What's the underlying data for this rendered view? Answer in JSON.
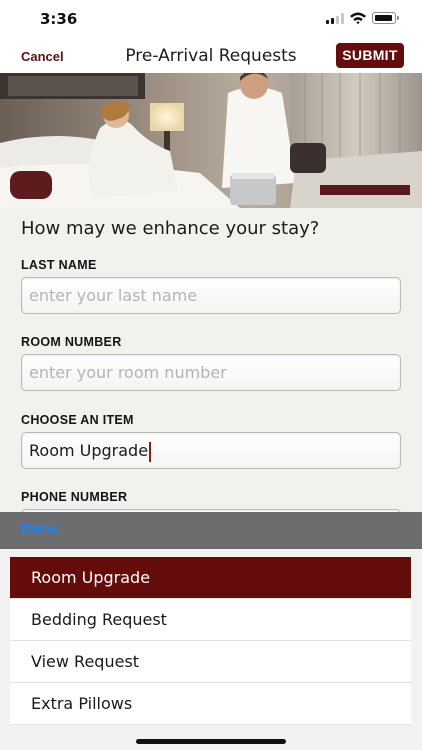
{
  "status_bar": {
    "time": "3:36"
  },
  "nav": {
    "cancel_label": "Cancel",
    "title": "Pre-Arrival Requests",
    "submit_label": "SUBMIT"
  },
  "form": {
    "question": "How may we enhance your stay?",
    "last_name": {
      "label": "LAST NAME",
      "placeholder": "enter your last name",
      "value": ""
    },
    "room_number": {
      "label": "ROOM NUMBER",
      "placeholder": "enter your room number",
      "value": ""
    },
    "choose_item": {
      "label": "CHOOSE AN ITEM",
      "value": "Room Upgrade"
    },
    "phone_number": {
      "label": "PHONE NUMBER"
    }
  },
  "toolbar": {
    "done_label": "Done"
  },
  "picker": {
    "selected": "Room Upgrade",
    "options": [
      "Room Upgrade",
      "Bedding Request",
      "View Request",
      "Extra Pillows"
    ]
  },
  "colors": {
    "accent": "#650d0d",
    "done_blue": "#1b84f5",
    "toolbar_gray": "#6d6d70"
  },
  "icons": [
    "signal-icon",
    "wifi-icon",
    "battery-icon"
  ]
}
